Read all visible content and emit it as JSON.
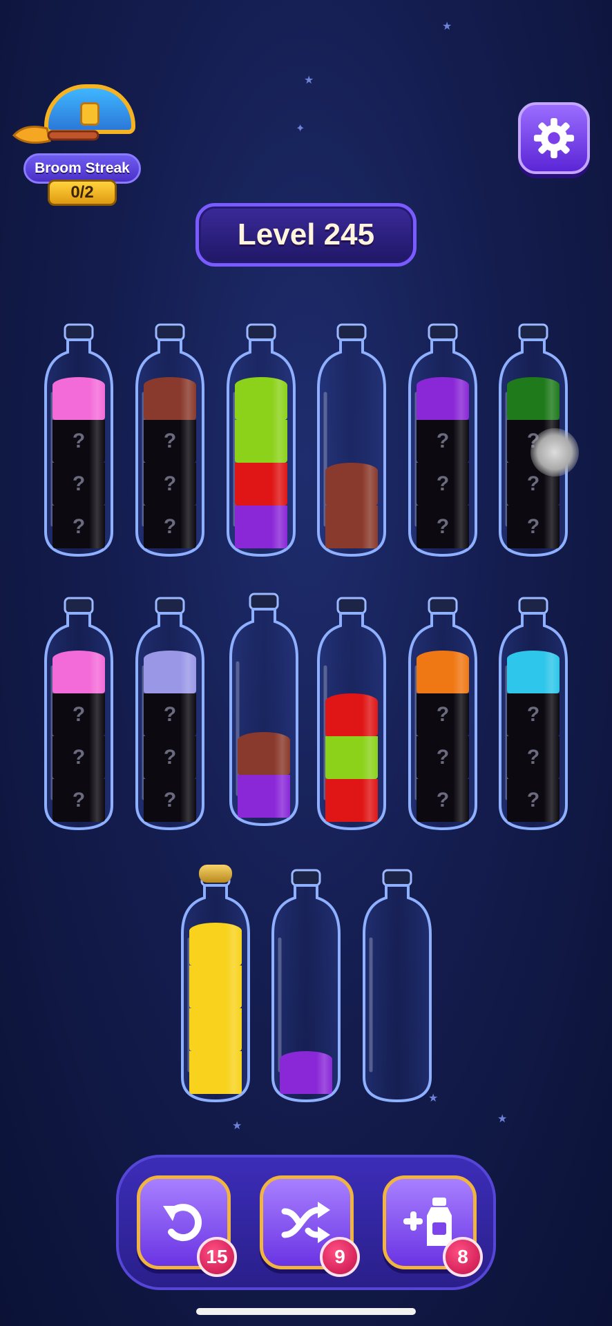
{
  "hud": {
    "streak_label": "Broom Streak",
    "streak_count": "0/2",
    "level_title": "Level 245",
    "settings_icon": "gear-icon"
  },
  "colors": {
    "pink": "#f36bd8",
    "brown": "#8a3a2c",
    "lime": "#8cd21a",
    "red": "#e01616",
    "purple": "#8a28d8",
    "green": "#1f7a1c",
    "lavender": "#9a98e6",
    "orange": "#f07814",
    "cyan": "#2ec6ea",
    "yellow": "#f8d21c",
    "hidden": "#0c0a10"
  },
  "bottles": [
    {
      "id": "b1",
      "segments": [
        "hidden",
        "hidden",
        "hidden",
        "pink"
      ]
    },
    {
      "id": "b2",
      "segments": [
        "hidden",
        "hidden",
        "hidden",
        "brown"
      ]
    },
    {
      "id": "b3",
      "segments": [
        "purple",
        "red",
        "lime",
        "lime"
      ]
    },
    {
      "id": "b4",
      "segments": [
        "brown",
        "brown"
      ]
    },
    {
      "id": "b5",
      "segments": [
        "hidden",
        "hidden",
        "hidden",
        "purple"
      ]
    },
    {
      "id": "b6",
      "segments": [
        "hidden",
        "hidden",
        "hidden",
        "green"
      ]
    },
    {
      "id": "b7",
      "segments": [
        "hidden",
        "hidden",
        "hidden",
        "pink"
      ]
    },
    {
      "id": "b8",
      "segments": [
        "hidden",
        "hidden",
        "hidden",
        "lavender"
      ]
    },
    {
      "id": "b9",
      "segments": [
        "purple",
        "brown"
      ]
    },
    {
      "id": "b10",
      "segments": [
        "red",
        "lime",
        "red"
      ]
    },
    {
      "id": "b11",
      "segments": [
        "hidden",
        "hidden",
        "hidden",
        "orange"
      ]
    },
    {
      "id": "b12",
      "segments": [
        "hidden",
        "hidden",
        "hidden",
        "cyan"
      ]
    },
    {
      "id": "b13",
      "segments": [
        "yellow",
        "yellow",
        "yellow",
        "yellow"
      ],
      "corked": true
    },
    {
      "id": "b14",
      "segments": [
        "purple"
      ]
    },
    {
      "id": "b15",
      "segments": []
    }
  ],
  "hidden_mark": "?",
  "tools": [
    {
      "name": "undo",
      "icon": "undo-icon",
      "count": "15"
    },
    {
      "name": "shuffle",
      "icon": "shuffle-icon",
      "count": "9"
    },
    {
      "name": "add-bottle",
      "icon": "add-bottle-icon",
      "count": "8"
    }
  ]
}
